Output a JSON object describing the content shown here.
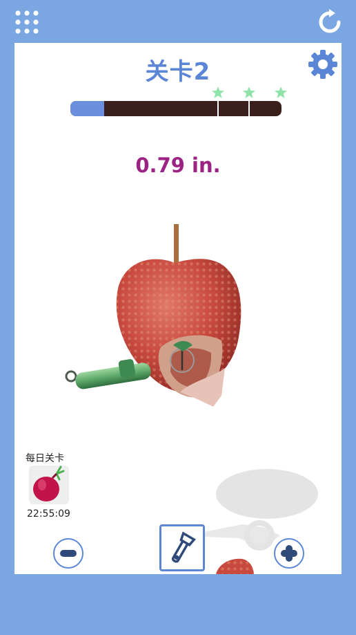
{
  "header": {
    "menu_icon": "grid-dots-icon",
    "restart_icon": "restart-icon"
  },
  "level": {
    "title": "关卡2",
    "settings_icon": "gear-icon"
  },
  "progress": {
    "fraction": 0.16,
    "stars": 3,
    "star_color": "#8fe3a8"
  },
  "measurement": "0.79 in.",
  "daily": {
    "label": "每日关卡",
    "timer": "22:55:09",
    "icon": "onion-icon"
  },
  "controls": {
    "minus_icon": "minus-icon",
    "plus_icon": "plus-icon",
    "tool_icon": "peeler-icon"
  },
  "colors": {
    "frame": "#7aa6e2",
    "accent": "#5b86d6",
    "measure": "#9c2283",
    "progress_track": "#3b1f1c"
  }
}
